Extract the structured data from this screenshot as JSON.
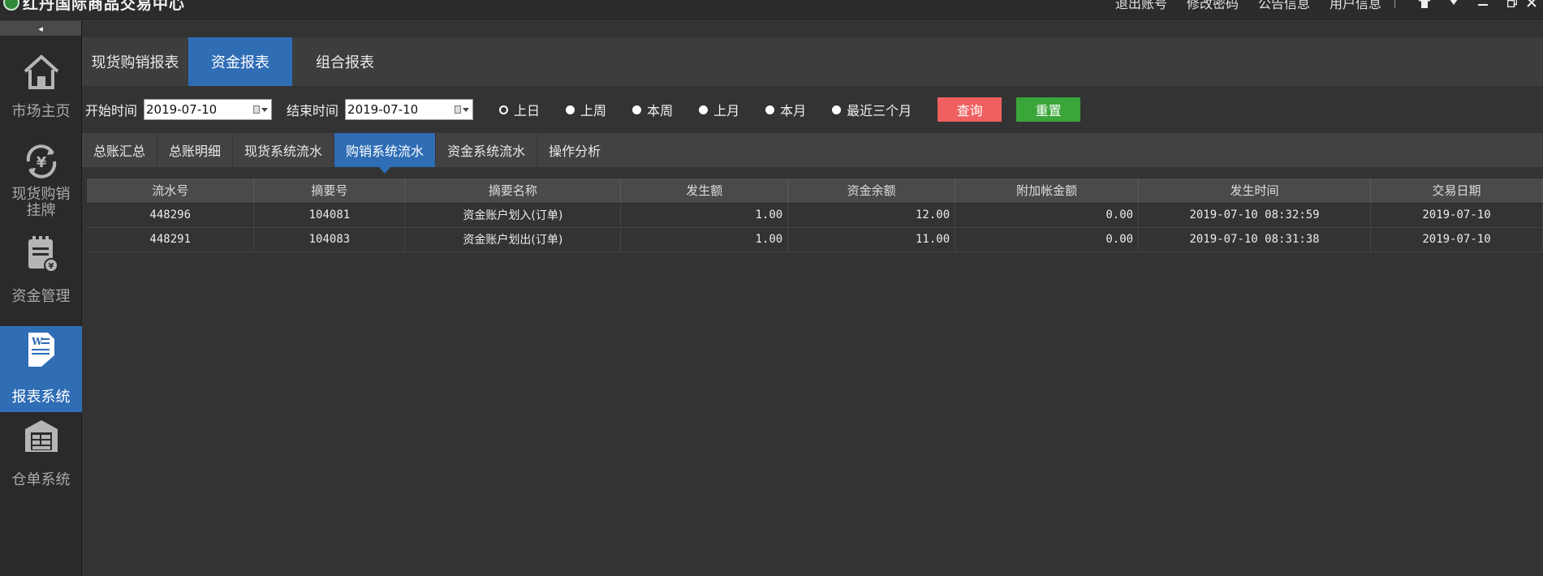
{
  "app": {
    "title": "红丹国际商品交易中心"
  },
  "toplinks": [
    "退出账号",
    "修改密码",
    "公告信息",
    "用户信息"
  ],
  "window_icons": [
    "shirt-icon",
    "dropdown-icon",
    "minimize-icon",
    "restore-icon",
    "close-icon"
  ],
  "sidebar": {
    "collapse_glyph": "◂",
    "items": [
      {
        "label": "市场主页",
        "icon": "home-icon",
        "active": false
      },
      {
        "label": "现货购销挂牌",
        "icon": "yuan-exchange-icon",
        "active": false
      },
      {
        "label": "资金管理",
        "icon": "fund-document-icon",
        "active": false
      },
      {
        "label": "报表系统",
        "icon": "report-document-icon",
        "active": true
      },
      {
        "label": "仓单系统",
        "icon": "warehouse-icon",
        "active": false
      }
    ]
  },
  "top_tabs": [
    {
      "label": "现货购销报表",
      "active": false
    },
    {
      "label": "资金报表",
      "active": true
    },
    {
      "label": "组合报表",
      "active": false
    }
  ],
  "filter": {
    "start_label": "开始时间",
    "start_value": "2019-07-10",
    "end_label": "结束时间",
    "end_value": "2019-07-10",
    "ranges": [
      {
        "label": "上日",
        "selected": true
      },
      {
        "label": "上周",
        "selected": false
      },
      {
        "label": "本周",
        "selected": false
      },
      {
        "label": "上月",
        "selected": false
      },
      {
        "label": "本月",
        "selected": false
      },
      {
        "label": "最近三个月",
        "selected": false
      }
    ],
    "query_label": "查询",
    "reset_label": "重置"
  },
  "sub_tabs": [
    {
      "label": "总账汇总",
      "active": false
    },
    {
      "label": "总账明细",
      "active": false
    },
    {
      "label": "现货系统流水",
      "active": false
    },
    {
      "label": "购销系统流水",
      "active": true
    },
    {
      "label": "资金系统流水",
      "active": false
    },
    {
      "label": "操作分析",
      "active": false
    }
  ],
  "table": {
    "columns": [
      "流水号",
      "摘要号",
      "摘要名称",
      "发生额",
      "资金余额",
      "附加帐金额",
      "发生时间",
      "交易日期"
    ],
    "rows": [
      [
        "448296",
        "104081",
        "资金账户划入(订单)",
        "1.00",
        "12.00",
        "0.00",
        "2019-07-10 08:32:59",
        "2019-07-10"
      ],
      [
        "448291",
        "104083",
        "资金账户划出(订单)",
        "1.00",
        "11.00",
        "0.00",
        "2019-07-10 08:31:38",
        "2019-07-10"
      ]
    ]
  },
  "colors": {
    "accent": "#2f6db5",
    "query_button": "#f06060",
    "reset_button": "#3aa63a",
    "background": "#333333",
    "sidebar": "#2a2a2a"
  }
}
